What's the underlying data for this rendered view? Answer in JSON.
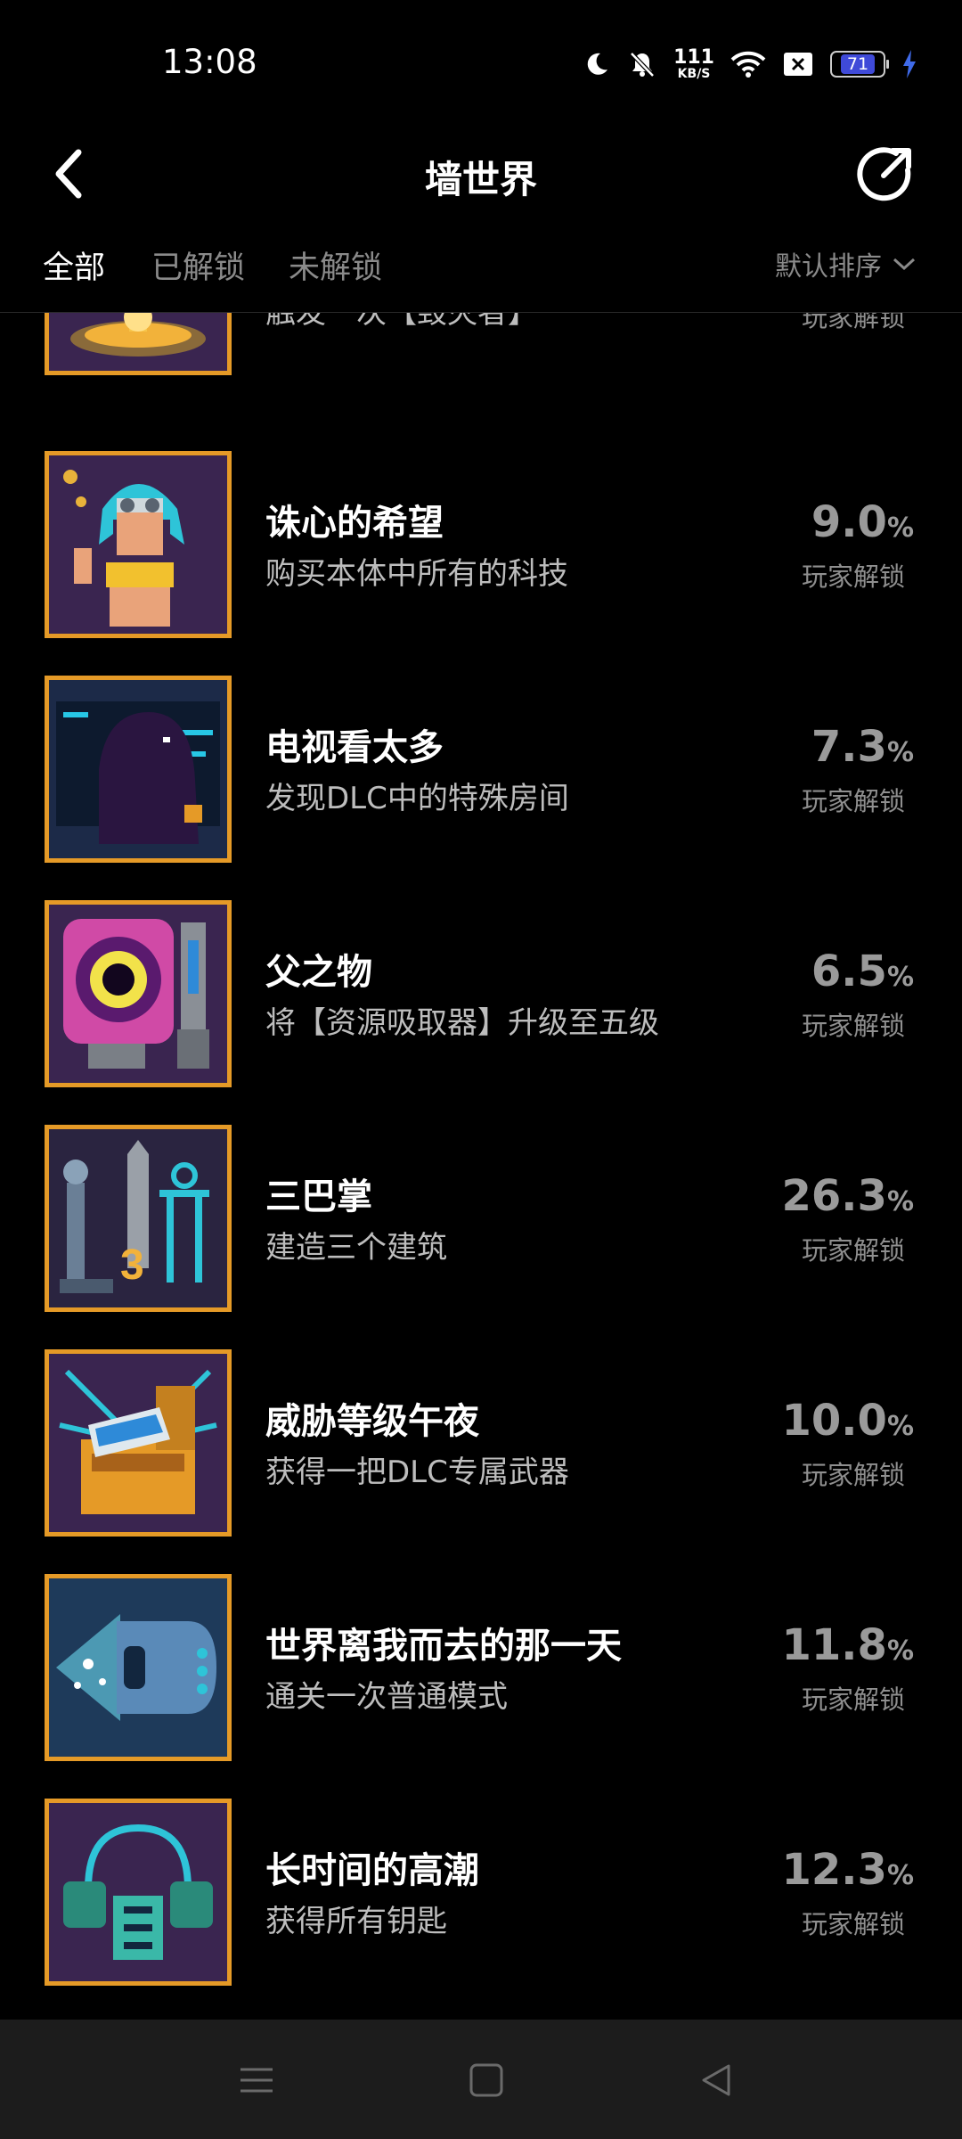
{
  "status_bar": {
    "time": "13:08",
    "net_speed": "111",
    "net_unit": "KB/S",
    "battery": "71"
  },
  "header": {
    "title": "墙世界"
  },
  "tabs": [
    {
      "label": "全部"
    },
    {
      "label": "已解锁"
    },
    {
      "label": "未解锁"
    }
  ],
  "sort": {
    "label": "默认排序"
  },
  "percent_sign": "%",
  "achievements": [
    {
      "name": "",
      "desc": "触发一次【毁灭者】",
      "percent": "",
      "percent_label": "玩家解锁",
      "icon": "fountain-icon"
    },
    {
      "name": "诛心的希望",
      "desc": "购买本体中所有的科技",
      "percent": "9.0",
      "percent_label": "玩家解锁",
      "icon": "blue-hair-girl-icon"
    },
    {
      "name": "电视看太多",
      "desc": "发现DLC中的特殊房间",
      "percent": "7.3",
      "percent_label": "玩家解锁",
      "icon": "hooded-figure-icon"
    },
    {
      "name": "父之物",
      "desc": "将【资源吸取器】升级至五级",
      "percent": "6.5",
      "percent_label": "玩家解锁",
      "icon": "vortex-machine-icon"
    },
    {
      "name": "三巴掌",
      "desc": "建造三个建筑",
      "percent": "26.3",
      "percent_label": "玩家解锁",
      "icon": "three-buildings-icon"
    },
    {
      "name": "威胁等级午夜",
      "desc": "获得一把DLC专属武器",
      "percent": "10.0",
      "percent_label": "玩家解锁",
      "icon": "weapon-chest-icon"
    },
    {
      "name": "世界离我而去的那一天",
      "desc": "通关一次普通模式",
      "percent": "11.8",
      "percent_label": "玩家解锁",
      "icon": "escape-ship-icon"
    },
    {
      "name": "长时间的高潮",
      "desc": "获得所有钥匙",
      "percent": "12.3",
      "percent_label": "玩家解锁",
      "icon": "key-device-icon"
    }
  ],
  "colors": {
    "background": "#000000",
    "thumb_border": "#e59a27",
    "percent": "#9a9a9a",
    "nav_bar": "#1c1c1c"
  }
}
